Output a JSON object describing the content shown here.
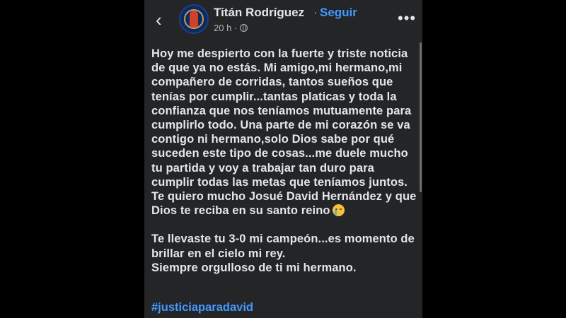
{
  "header": {
    "author_name": "Titán Rodríguez",
    "separator": "·",
    "follow_label": "Seguir",
    "time": "20 h ·",
    "back_icon": "chevron-left-icon",
    "more_icon": "more-horizontal-icon",
    "privacy_icon": "globe-icon"
  },
  "post": {
    "paragraph1": "Hoy me despierto con la fuerte y triste noticia de que ya no estás. Mi amigo,mi hermano,mi compañero de corridas, tantos sueños que tenías por cumplir...tantas platicas y toda la confianza que nos teníamos mutuamente para cumplirlo todo. Una parte de mi corazón se va contigo ni hermano,solo Dios sabe por qué suceden este tipo de cosas...me duele mucho tu partida y voy a trabajar tan duro para cumplir todas las metas que teníamos juntos.",
    "paragraph2": "Te quiero mucho Josué David Hernández y que Dios te reciba en su santo reino",
    "emoji": "crying-face-emoji",
    "paragraph3": "Te llevaste tu 3-0 mi campeón...es momento de brillar en el cielo mi rey.",
    "paragraph4": "Siempre orgulloso de ti mi hermano.",
    "hashtag": "#justiciaparadavid"
  },
  "colors": {
    "background": "#242526",
    "text": "#e4e6eb",
    "secondary_text": "#b0b3b8",
    "link": "#4599ff"
  }
}
